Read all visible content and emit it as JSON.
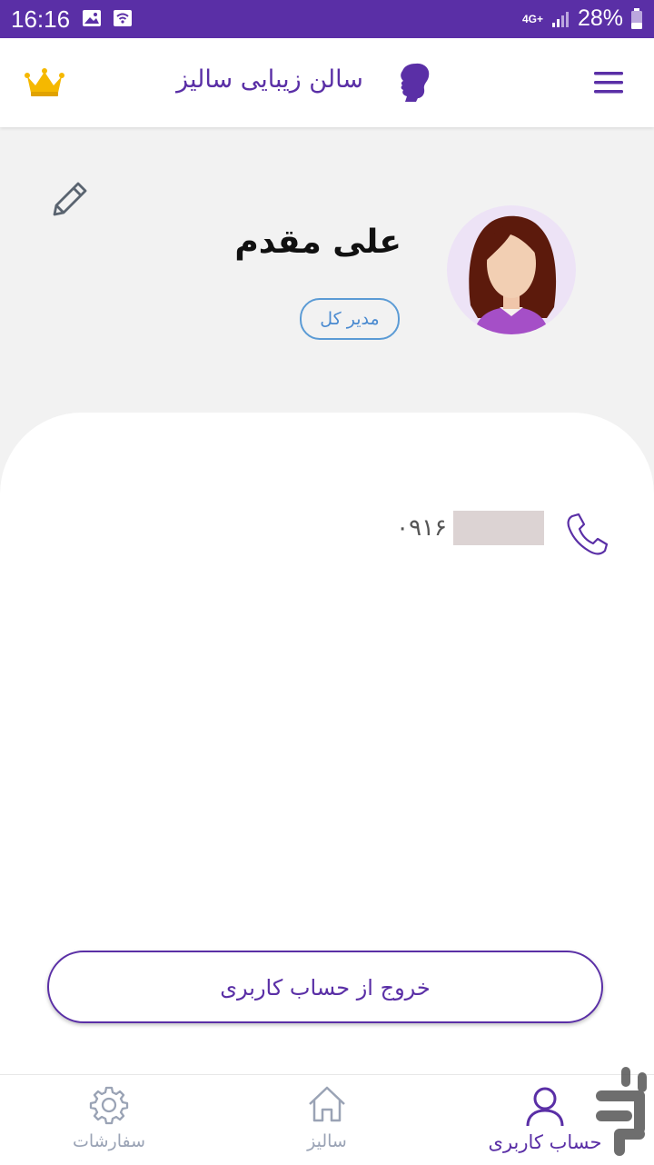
{
  "status_bar": {
    "time": "16:16",
    "network": "4G+",
    "battery": "28%"
  },
  "app_bar": {
    "title": "سالن زیبایی سالیز",
    "menu_icon": "hamburger-menu-icon",
    "logo_icon": "woman-silhouette-icon",
    "crown_icon": "crown-icon"
  },
  "profile": {
    "name": "علی مقدم",
    "role": "مدیر کل",
    "edit_icon": "pencil-icon",
    "avatar_icon": "woman-avatar-icon"
  },
  "contact": {
    "phone_prefix": "۰۹۱۶"
  },
  "logout": {
    "label": "خروج از حساب کاربری"
  },
  "bottom_nav": {
    "items": [
      {
        "label": "حساب کاربری",
        "icon": "user-icon",
        "active": true
      },
      {
        "label": "سالیز",
        "icon": "home-icon",
        "active": false
      },
      {
        "label": "سفارشات",
        "icon": "gear-icon",
        "active": false
      }
    ]
  },
  "colors": {
    "primary": "#5a2fa6",
    "badge": "#5b9bd5",
    "inactive": "#9aa3b5",
    "crown": "#f5b800"
  }
}
